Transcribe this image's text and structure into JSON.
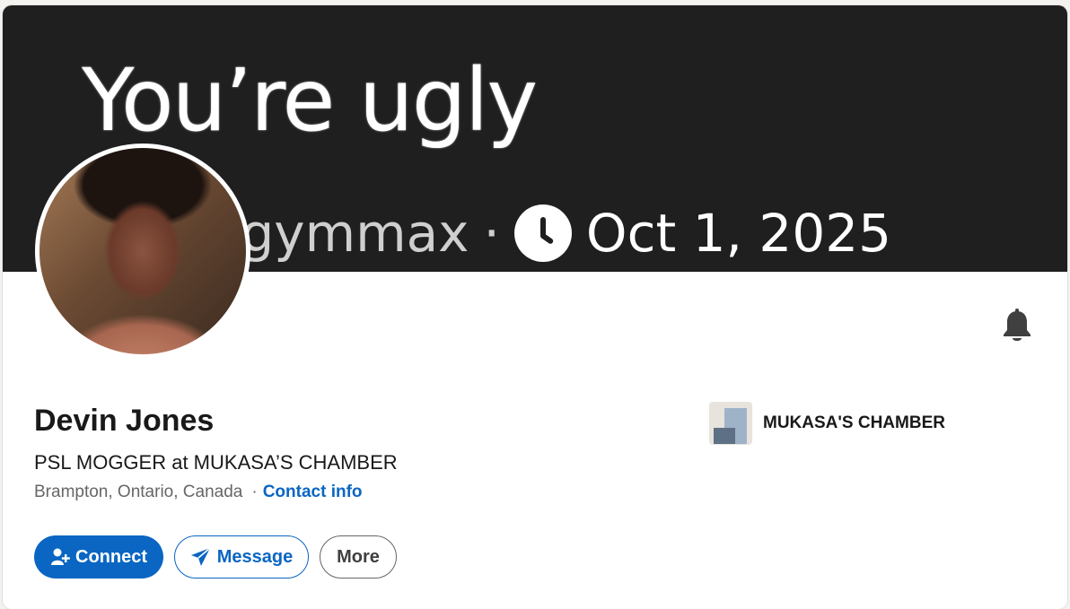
{
  "banner": {
    "headline": "You’re ugly",
    "handle": "ckgymmax",
    "separator": "·",
    "date": "Oct 1, 2025"
  },
  "profile": {
    "name": "Devin Jones",
    "headline": "PSL MOGGER at MUKASA’S CHAMBER",
    "location": "Brampton, Ontario, Canada",
    "separator": "·",
    "contact_info_label": "Contact info"
  },
  "company": {
    "name": "MUKASA'S CHAMBER"
  },
  "actions": {
    "connect_label": "Connect",
    "message_label": "Message",
    "more_label": "More"
  },
  "icons": {
    "bell": "bell-icon",
    "clock": "clock-icon",
    "connect": "add-person-icon",
    "message": "send-icon"
  },
  "colors": {
    "accent": "#0a66c2",
    "banner_bg": "#1f1f1f",
    "text_primary": "#191919",
    "text_secondary": "#666666"
  }
}
